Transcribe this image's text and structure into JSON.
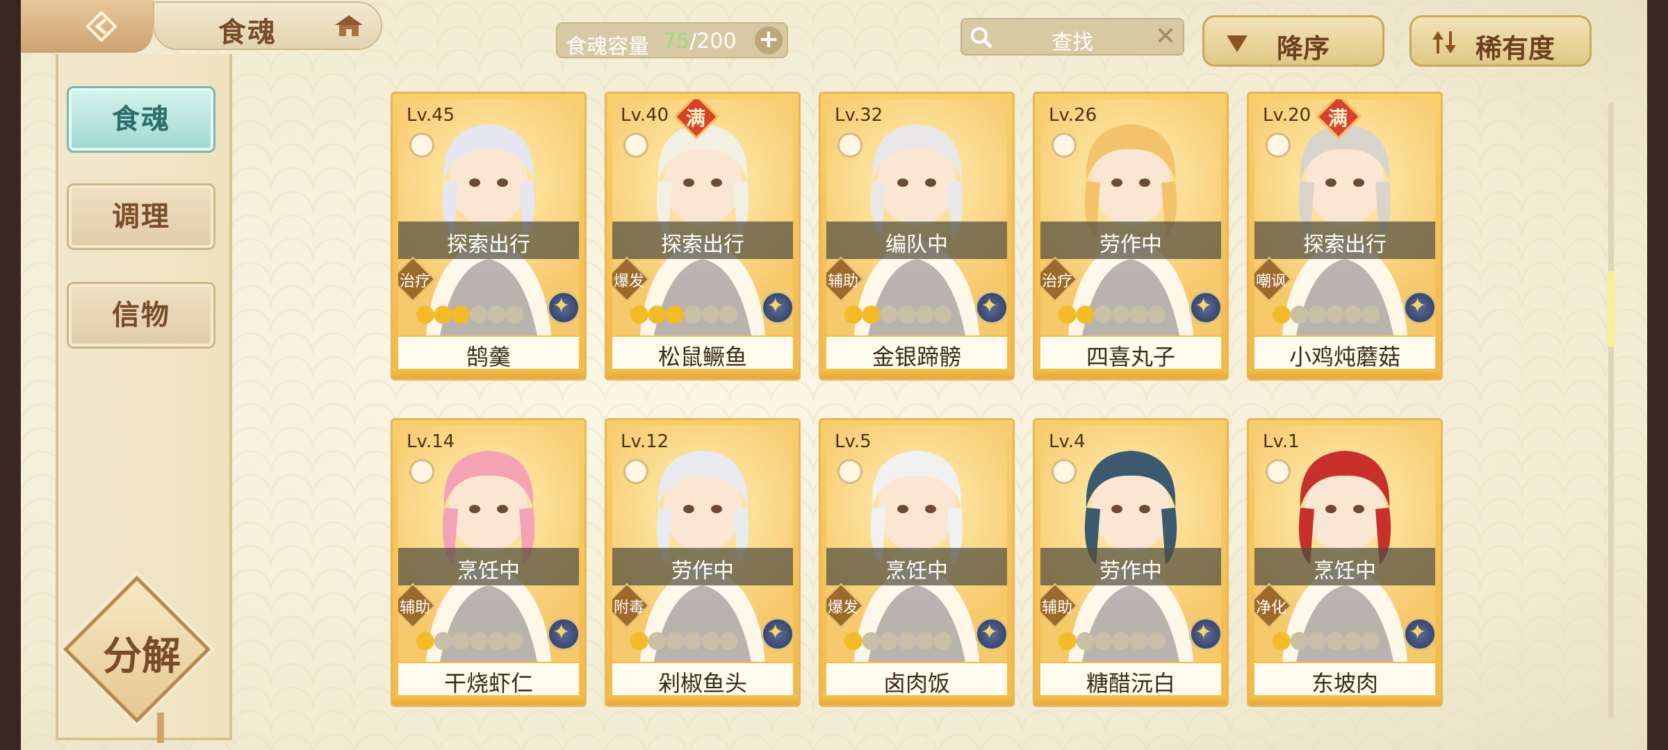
{
  "header": {
    "title": "食魂",
    "capacity_label": "食魂容量",
    "capacity_current": "75",
    "capacity_max": "/200",
    "search_placeholder": "查找",
    "sort_order_label": "降序",
    "sort_rarity_label": "稀有度"
  },
  "sidebar": {
    "items": [
      {
        "label": "食魂",
        "active": true
      },
      {
        "label": "调理",
        "active": false
      },
      {
        "label": "信物",
        "active": false
      }
    ],
    "decompose_label": "分解"
  },
  "cards": [
    {
      "level": "Lv.45",
      "full": false,
      "status": "探索出行",
      "role": "治疗",
      "stars": 3,
      "name": "鹄羹",
      "hair": "#e6e6f0"
    },
    {
      "level": "Lv.40",
      "full": true,
      "full_label": "满",
      "status": "探索出行",
      "role": "爆发",
      "stars": 3,
      "name": "松鼠鳜鱼",
      "hair": "#f2efe4"
    },
    {
      "level": "Lv.32",
      "full": false,
      "status": "编队中",
      "role": "辅助",
      "stars": 2,
      "name": "金银蹄髈",
      "hair": "#e9e7e7"
    },
    {
      "level": "Lv.26",
      "full": false,
      "status": "劳作中",
      "role": "治疗",
      "stars": 2,
      "name": "四喜丸子",
      "hair": "#f2c36a"
    },
    {
      "level": "Lv.20",
      "full": true,
      "full_label": "满",
      "status": "探索出行",
      "role": "嘲讽",
      "stars": 1,
      "name": "小鸡炖蘑菇",
      "hair": "#d8d4cc"
    },
    {
      "level": "Lv.14",
      "full": false,
      "status": "烹饪中",
      "role": "辅助",
      "stars": 1,
      "name": "干烧虾仁",
      "hair": "#f4a3b4"
    },
    {
      "level": "Lv.12",
      "full": false,
      "status": "劳作中",
      "role": "附毒",
      "stars": 1,
      "name": "剁椒鱼头",
      "hair": "#e8eaee"
    },
    {
      "level": "Lv.5",
      "full": false,
      "status": "烹饪中",
      "role": "爆发",
      "stars": 1,
      "name": "卤肉饭",
      "hair": "#f1f1f1"
    },
    {
      "level": "Lv.4",
      "full": false,
      "status": "劳作中",
      "role": "辅助",
      "stars": 1,
      "name": "糖醋沅白",
      "hair": "#3b5a6f"
    },
    {
      "level": "Lv.1",
      "full": false,
      "status": "烹饪中",
      "role": "净化",
      "stars": 1,
      "name": "东坡肉",
      "hair": "#c8302c"
    }
  ],
  "max_stars": 6,
  "colors": {
    "accent_teal": "#9fd8d0",
    "card_gold": "#f3b848",
    "capacity_green": "#93e07d"
  }
}
